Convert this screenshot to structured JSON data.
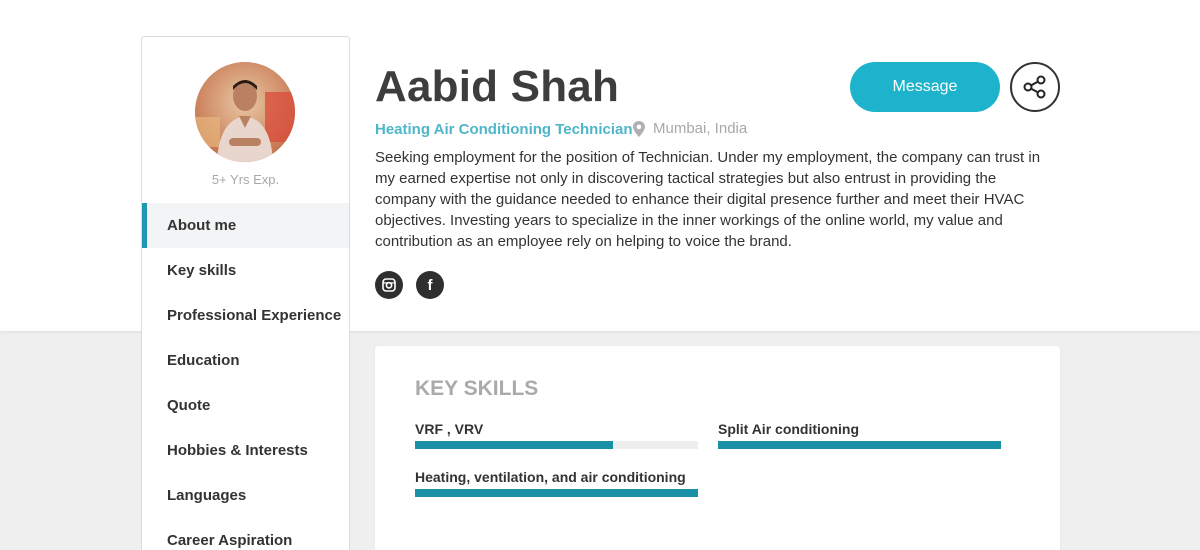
{
  "profile": {
    "name": "Aabid Shah",
    "role": "Heating Air Conditioning Technician",
    "location": "Mumbai, India",
    "experience": "5+ Yrs Exp.",
    "bio": "Seeking employment for the position of Technician. Under my employment, the company can trust in my earned expertise not only in discovering tactical strategies but also entrust in providing the company with the guidance needed to enhance their digital presence further and meet their HVAC objectives. Investing years to specialize in the inner workings of the online world, my value and contribution as an employee rely on helping to voice the brand."
  },
  "actions": {
    "message_label": "Message",
    "share_icon": "share-icon"
  },
  "social": [
    {
      "name": "instagram",
      "icon": "instagram-icon"
    },
    {
      "name": "facebook",
      "icon": "facebook-icon",
      "glyph": "f"
    }
  ],
  "sidebar": {
    "items": [
      {
        "label": "About me",
        "active": true
      },
      {
        "label": "Key skills"
      },
      {
        "label": "Professional Experience"
      },
      {
        "label": "Education"
      },
      {
        "label": "Quote"
      },
      {
        "label": "Hobbies & Interests"
      },
      {
        "label": "Languages"
      },
      {
        "label": "Career Aspiration"
      }
    ]
  },
  "key_skills": {
    "title": "KEY SKILLS",
    "skills": [
      {
        "label": "VRF , VRV",
        "level": 0.7
      },
      {
        "label": "Split Air conditioning",
        "level": 1.0
      },
      {
        "label": "Heating, ventilation, and air conditioning",
        "level": 1.0
      }
    ]
  },
  "colors": {
    "accent": "#1eb3cc",
    "role_text": "#4eb6c9",
    "skill_bar": "#1991a6",
    "active_border": "#1d99b0"
  }
}
